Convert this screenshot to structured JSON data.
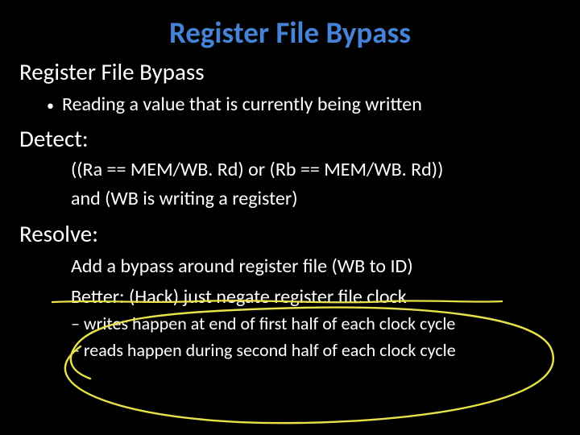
{
  "title": "Register File Bypass",
  "subtitle": "Register File Bypass",
  "bullet": "Reading a value that is currently being written",
  "detect": {
    "heading": "Detect:",
    "line1": "((Ra == MEM/WB. Rd) or (Rb == MEM/WB. Rd))",
    "line2": "and (WB is writing a register)"
  },
  "resolve": {
    "heading": "Resolve:",
    "line1": "Add a bypass around register file (WB to ID)",
    "line2": "Better: (Hack) just negate register file clock",
    "sub1": "– writes happen at end of first half of each clock cycle",
    "sub2": "– reads happen during second half of each clock cycle"
  }
}
